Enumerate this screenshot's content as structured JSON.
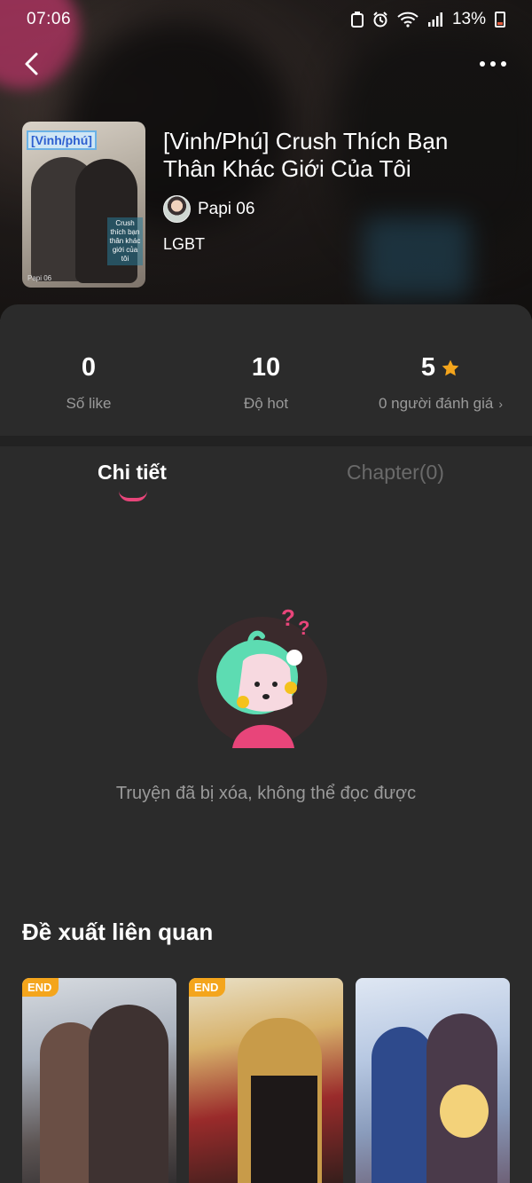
{
  "status_bar": {
    "time": "07:06",
    "battery": "13%",
    "icons": [
      "notification-icon",
      "alarm-icon",
      "wifi-icon",
      "signal-icon",
      "battery-icon"
    ]
  },
  "book": {
    "title": "[Vinh/Phú] Crush Thích Bạn Thân Khác Giới Của Tôi",
    "author": "Papi 06",
    "genre": "LGBT",
    "cover_tag": "[Vinh/phú]",
    "cover_title": "Crush thích bạn thân khác giới của tôi",
    "cover_author": "Papi 06"
  },
  "stats": {
    "likes_value": "0",
    "likes_label": "Số like",
    "hot_value": "10",
    "hot_label": "Độ hot",
    "rating_value": "5",
    "rating_label": "0 người đánh giá"
  },
  "tabs": {
    "detail": "Chi tiết",
    "chapters": "Chapter(0)"
  },
  "empty_state": {
    "message": "Truyện đã bị xóa, không thể đọc được"
  },
  "recommendations": {
    "title": "Đề xuất liên quan",
    "items": [
      {
        "badge": "END"
      },
      {
        "badge": "END"
      },
      {
        "badge": ""
      }
    ]
  },
  "colors": {
    "accent": "#e8457a",
    "star": "#f4a51c",
    "background": "#2b2b2b"
  }
}
